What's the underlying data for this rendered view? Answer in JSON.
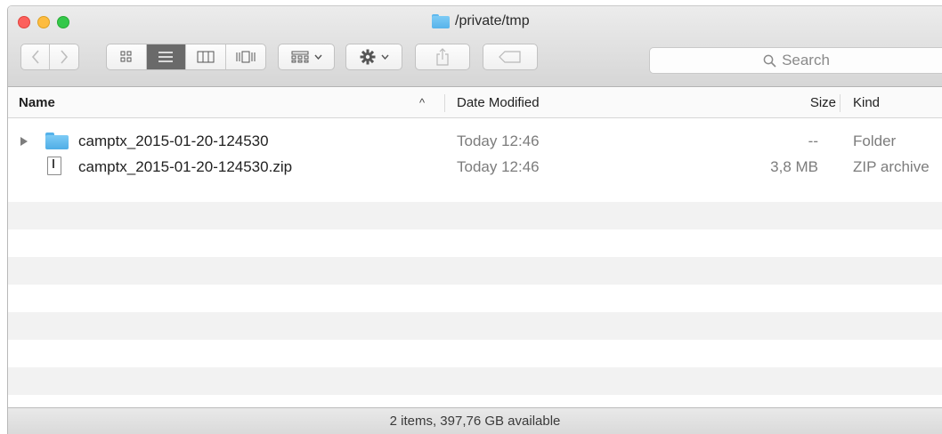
{
  "window": {
    "title": "/private/tmp"
  },
  "toolbar": {
    "back_icon": "chevron-left-icon",
    "forward_icon": "chevron-right-icon",
    "view_modes": [
      {
        "icon": "icon-view-icon",
        "active": false
      },
      {
        "icon": "list-view-icon",
        "active": true
      },
      {
        "icon": "column-view-icon",
        "active": false
      },
      {
        "icon": "cover-flow-view-icon",
        "active": false
      }
    ],
    "arrange_icon": "arrange-grid-icon",
    "action_icon": "gear-icon",
    "share_icon": "share-icon",
    "tag_icon": "tag-icon"
  },
  "search": {
    "placeholder": "Search"
  },
  "columns": {
    "name": "Name",
    "date_modified": "Date Modified",
    "size": "Size",
    "kind": "Kind",
    "sort_indicator": "^"
  },
  "files": [
    {
      "name": "camptx_2015-01-20-124530",
      "date_modified": "Today 12:46",
      "size": "--",
      "kind": "Folder",
      "icon": "folder-icon",
      "expandable": true
    },
    {
      "name": "camptx_2015-01-20-124530.zip",
      "date_modified": "Today 12:46",
      "size": "3,8 MB",
      "kind": "ZIP archive",
      "icon": "zip-file-icon",
      "expandable": false
    }
  ],
  "status": {
    "text": "2 items, 397,76 GB available"
  },
  "colors": {
    "stripe": "#f2f2f2",
    "selected_view": "#6a6a6a",
    "folder": "#5fb8ee"
  }
}
